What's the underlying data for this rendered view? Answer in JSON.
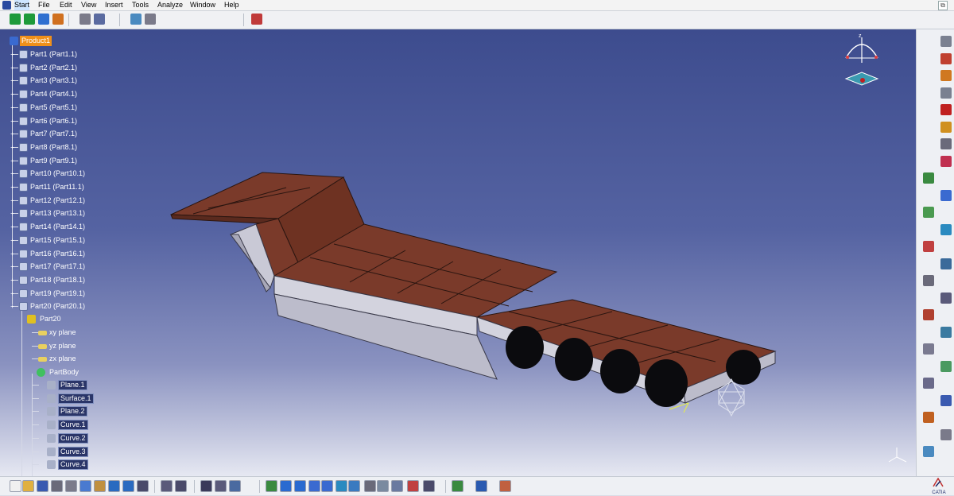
{
  "menubar": {
    "items": [
      "Start",
      "File",
      "Edit",
      "View",
      "Insert",
      "Tools",
      "Analyze",
      "Window",
      "Help"
    ],
    "active": "Start"
  },
  "tree": {
    "root": "Product1",
    "parts": [
      "Part1 (Part1.1)",
      "Part2 (Part2.1)",
      "Part3 (Part3.1)",
      "Part4 (Part4.1)",
      "Part5 (Part5.1)",
      "Part6 (Part6.1)",
      "Part7 (Part7.1)",
      "Part8 (Part8.1)",
      "Part9 (Part9.1)",
      "Part10 (Part10.1)",
      "Part11 (Part11.1)",
      "Part12 (Part12.1)",
      "Part13 (Part13.1)",
      "Part14 (Part14.1)",
      "Part15 (Part15.1)",
      "Part16 (Part16.1)",
      "Part17 (Part17.1)",
      "Part18 (Part18.1)",
      "Part19 (Part19.1)",
      "Part20 (Part20.1)"
    ],
    "part20": {
      "label": "Part20",
      "planes": [
        "xy plane",
        "yz plane",
        "zx plane"
      ],
      "partbody": {
        "label": "PartBody",
        "features": [
          "Plane.1",
          "Surface.1",
          "Plane.2",
          "Curve.1",
          "Curve.2",
          "Curve.3",
          "Curve.4"
        ]
      }
    }
  },
  "compass": {
    "axis_label": "z"
  },
  "logo": {
    "text": "CATIA"
  },
  "colors": {
    "viewport_top": "#3d4c8e",
    "viewport_bottom": "#e6e8f2",
    "deck": "#7a3a2a",
    "frame": "#c9c9d6",
    "selected": "#f0901a"
  },
  "icons": {
    "top_toolbar": [
      "move-icon",
      "pan-icon",
      "fly-icon",
      "measure-icon",
      "sketch-icon",
      "product-icon",
      "save-icon",
      "settings-icon",
      "knowledge-icon"
    ],
    "bottom_toolbar": [
      "new-icon",
      "open-icon",
      "save-icon",
      "print-icon",
      "cut-icon",
      "copy-icon",
      "paste-icon",
      "undo-icon",
      "redo-icon",
      "help-icon",
      "formula-icon",
      "macro-icon",
      "table-icon",
      "catalog-icon",
      "graph-icon",
      "fit-all-icon",
      "pan-icon",
      "rotate-icon",
      "zoom-in-icon",
      "zoom-out-icon",
      "normal-view-icon",
      "iso-view-icon",
      "shading-icon",
      "hide-show-icon",
      "swap-icon",
      "material-icon",
      "camera-icon",
      "analysis-icon",
      "measure-icon",
      "grid-icon"
    ]
  }
}
